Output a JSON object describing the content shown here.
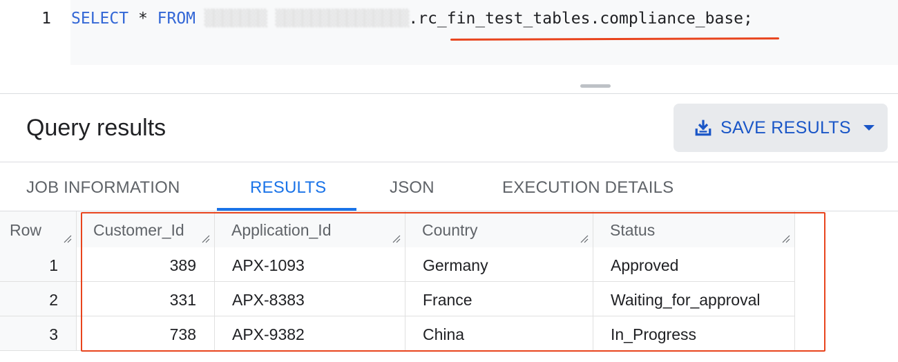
{
  "editor": {
    "line_number": "1",
    "sql_select": "SELECT",
    "sql_star": " * ",
    "sql_from": "FROM",
    "sql_redacted": " ▒▒▒▒▒▒▒ ▒▒▒▒▒▒▒▒▒▒▒▒▒▒▒",
    "sql_table": ".rc_fin_test_tables.compliance_base;"
  },
  "header": {
    "title": "Query results",
    "save_label": "SAVE RESULTS"
  },
  "tabs": [
    {
      "label": "JOB INFORMATION"
    },
    {
      "label": "RESULTS"
    },
    {
      "label": "JSON"
    },
    {
      "label": "EXECUTION DETAILS"
    }
  ],
  "table": {
    "columns": [
      "Row",
      "Customer_Id",
      "Application_Id",
      "Country",
      "Status"
    ],
    "rows": [
      {
        "row": "1",
        "customer_id": "389",
        "application_id": "APX-1093",
        "country": "Germany",
        "status": "Approved"
      },
      {
        "row": "2",
        "customer_id": "331",
        "application_id": "APX-8383",
        "country": "France",
        "status": "Waiting_for_approval"
      },
      {
        "row": "3",
        "customer_id": "738",
        "application_id": "APX-9382",
        "country": "China",
        "status": "In_Progress"
      }
    ]
  },
  "colors": {
    "accent": "#1a73e8",
    "keyword": "#3367d6",
    "annotation": "#e8431c"
  },
  "icons": [
    "download-icon",
    "caret-down-icon",
    "column-resize-icon"
  ]
}
